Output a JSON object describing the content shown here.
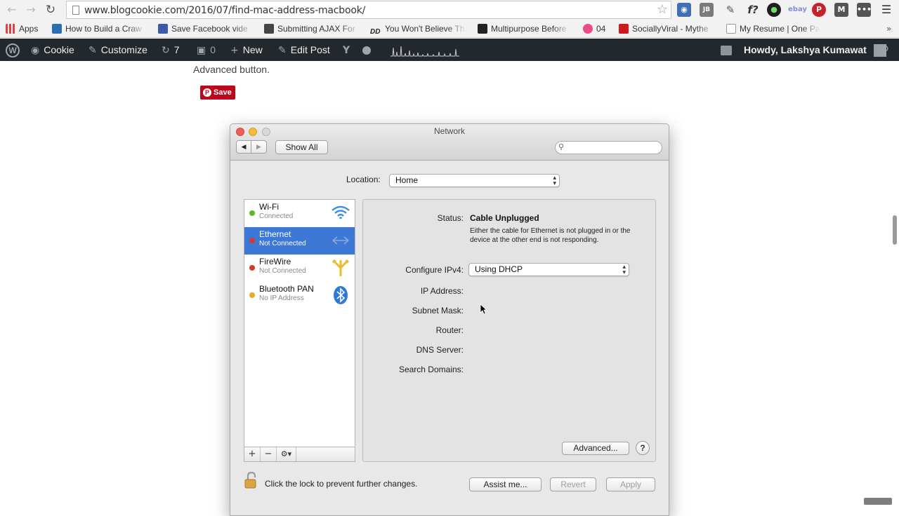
{
  "browser": {
    "url": "www.blogcookie.com/2016/07/find-mac-address-macbook/",
    "back_icon": "arrow-left-icon",
    "forward_icon": "arrow-right-icon",
    "reload_icon": "reload-icon",
    "extensions": [
      "gitlab-icon",
      "jb-icon",
      "eyedropper-icon",
      "font-icon",
      "circle-icon",
      "ebay-icon",
      "pinterest-icon",
      "medium-icon",
      "more-icon",
      "menu-icon"
    ]
  },
  "bookmarks": [
    {
      "label": "Apps",
      "icon": "apps-grid-icon",
      "color": "#555555"
    },
    {
      "label": "How to Build a Craw",
      "icon": "blog-icon",
      "color": "#2a6fb0"
    },
    {
      "label": "Save Facebook vide",
      "icon": "check-icon",
      "color": "#3a5aa8"
    },
    {
      "label": "Submitting AJAX For",
      "icon": "thumb-icon",
      "color": "#444444"
    },
    {
      "label": "You Won't Believe Th",
      "icon": "dd-icon",
      "color": "#222222"
    },
    {
      "label": "Multipurpose Before",
      "icon": "arrow-icon",
      "color": "#222222"
    },
    {
      "label": "04",
      "icon": "dribbble-icon",
      "color": "#ea4c89"
    },
    {
      "label": "SociallyViral - Mythe",
      "icon": "tl-icon",
      "color": "#d0191a"
    },
    {
      "label": "My Resume | One Pa",
      "icon": "page-icon",
      "color": "#999999"
    }
  ],
  "adminbar": {
    "site": "Cookie",
    "customize": "Customize",
    "updates": "7",
    "comments": "0",
    "new": "New",
    "edit": "Edit Post",
    "howdy": "Howdy, Lakshya Kumawat"
  },
  "page": {
    "text": "Advanced button.",
    "pin_save": "Save"
  },
  "network_window": {
    "title": "Network",
    "show_all": "Show All",
    "location_label": "Location:",
    "location_value": "Home",
    "services": [
      {
        "name": "Wi-Fi",
        "status": "Connected",
        "dot": "#5ab72e",
        "icon": "wifi-icon"
      },
      {
        "name": "Ethernet",
        "status": "Not Connected",
        "dot": "#d33b2c",
        "icon": "ethernet-icon"
      },
      {
        "name": "FireWire",
        "status": "Not Connected",
        "dot": "#d33b2c",
        "icon": "firewire-icon"
      },
      {
        "name": "Bluetooth PAN",
        "status": "No IP Address",
        "dot": "#e7a92b",
        "icon": "bluetooth-icon"
      }
    ],
    "detail": {
      "status_label": "Status:",
      "status_value": "Cable Unplugged",
      "status_desc": "Either the cable for Ethernet is not plugged in or the device at the other end is not responding.",
      "configure_label": "Configure IPv4:",
      "configure_value": "Using DHCP",
      "ip_label": "IP Address:",
      "subnet_label": "Subnet Mask:",
      "router_label": "Router:",
      "dns_label": "DNS Server:",
      "search_label": "Search Domains:",
      "advanced": "Advanced...",
      "help": "?"
    },
    "lock_text": "Click the lock to prevent further changes.",
    "assist": "Assist me...",
    "revert": "Revert",
    "apply": "Apply"
  },
  "colors": {
    "admin_bar": "#23282d",
    "selection": "#3d78d6",
    "pinterest": "#bd081c"
  }
}
